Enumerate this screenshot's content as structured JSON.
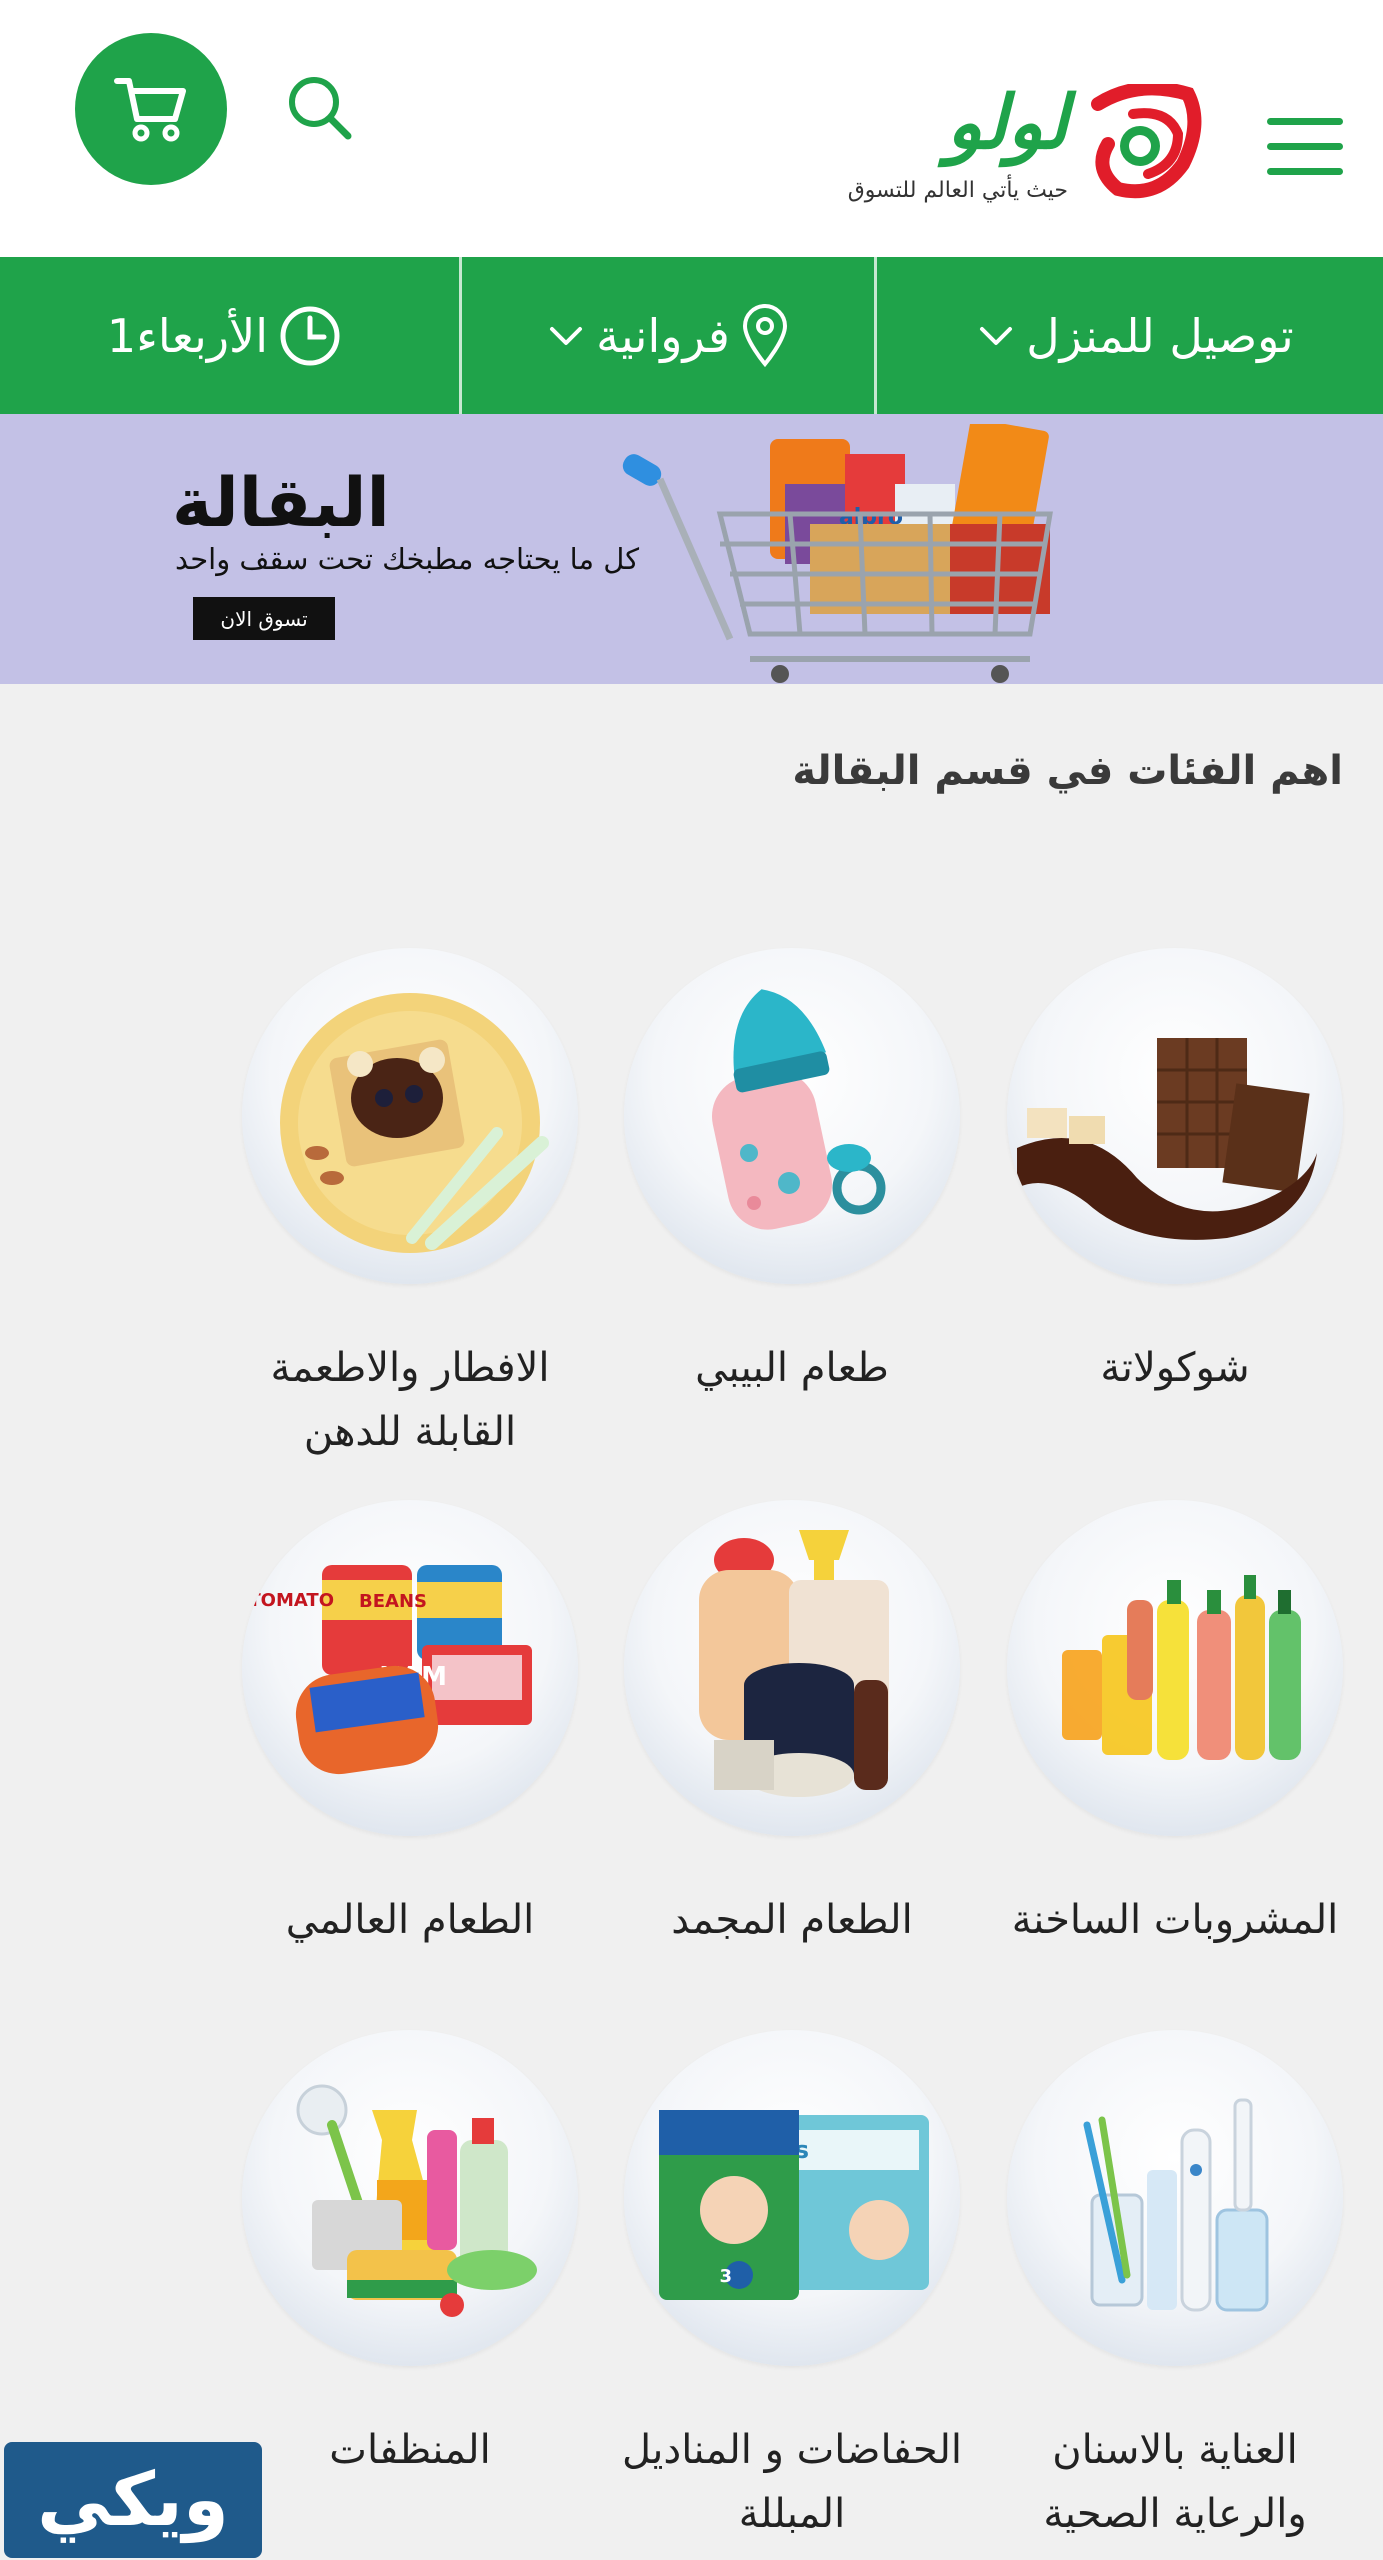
{
  "header": {
    "logo_text": "لولو",
    "logo_tagline": "حيث يأتي العالم للتسوق",
    "menu_icon": "hamburger-menu-icon",
    "search_icon": "search-icon",
    "cart_icon": "cart-icon"
  },
  "delivery_bar": {
    "delivery_label": "توصيل للمنزل",
    "location_label": "فروانية",
    "day_label": "الأربعاء1"
  },
  "banner": {
    "title": "البقالة",
    "subtitle": "كل ما يحتاجه مطبخك تحت سقف واحد",
    "button_label": "تسوق الان"
  },
  "section": {
    "title": "اهم الفئات في قسم البقالة"
  },
  "categories": [
    {
      "label": "شوكولاتة",
      "image": "chocolate"
    },
    {
      "label": "طعام البيبي",
      "image": "baby-bottle"
    },
    {
      "label": "الافطار والاطعمة القابلة للدهن",
      "image": "breakfast-toast"
    },
    {
      "label": "المشروبات الساخنة",
      "image": "juice-bottles"
    },
    {
      "label": "الطعام المجمد",
      "image": "frozen-food"
    },
    {
      "label": "الطعام العالمي",
      "image": "canned-food"
    },
    {
      "label": "العناية بالاسنان والرعاية الصحية",
      "image": "toothbrushes"
    },
    {
      "label": "الحفاضات و المناديل المبللة",
      "image": "diapers"
    },
    {
      "label": "المنظفات",
      "image": "cleaning-supplies"
    }
  ],
  "colors": {
    "brand_green": "#1fa34a",
    "banner_bg": "#c3c1e6",
    "page_bg": "#f0f0f0",
    "logo_red": "#e11d2a"
  }
}
